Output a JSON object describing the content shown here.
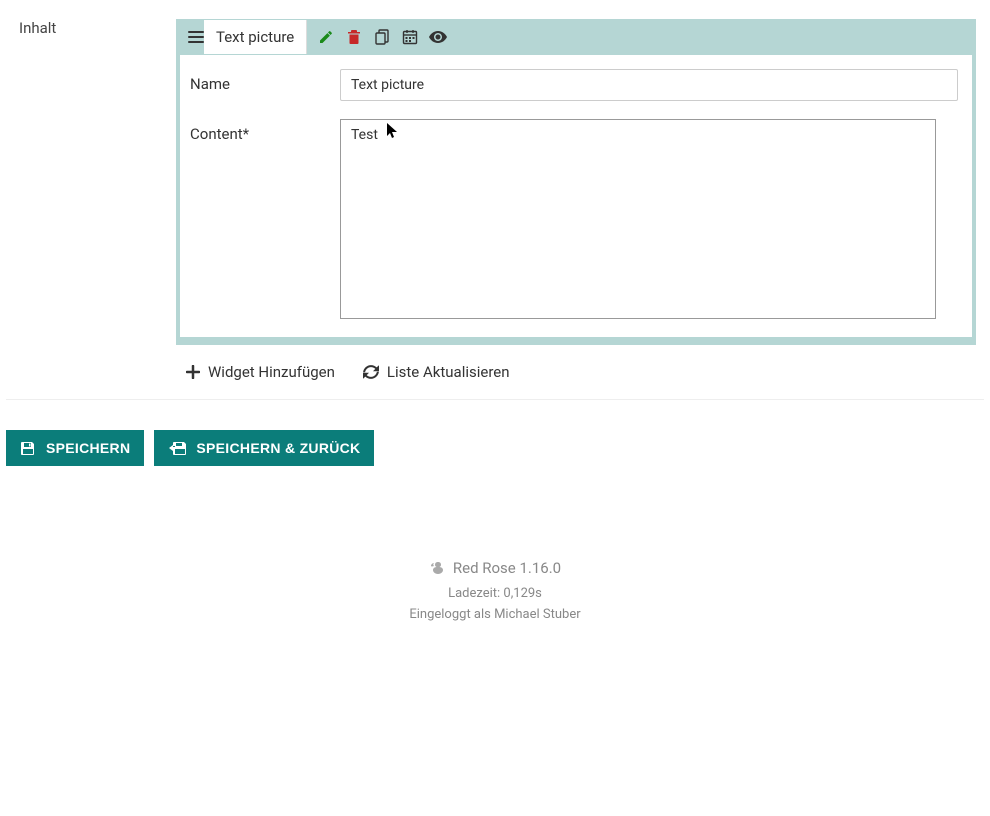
{
  "sidebar": {
    "label": "Inhalt"
  },
  "widget": {
    "tab_label": "Text picture",
    "fields": {
      "name": {
        "label": "Name",
        "value": "Text picture"
      },
      "content": {
        "label": "Content*",
        "value": "Test"
      }
    }
  },
  "actions": {
    "add_widget": "Widget Hinzufügen",
    "refresh_list": "Liste Aktualisieren"
  },
  "buttons": {
    "save": "SPEICHERN",
    "save_back": "SPEICHERN & ZURÜCK"
  },
  "footer": {
    "app": "Red Rose 1.16.0",
    "loadtime": "Ladezeit: 0,129s",
    "user": "Eingeloggt als Michael Stuber"
  }
}
